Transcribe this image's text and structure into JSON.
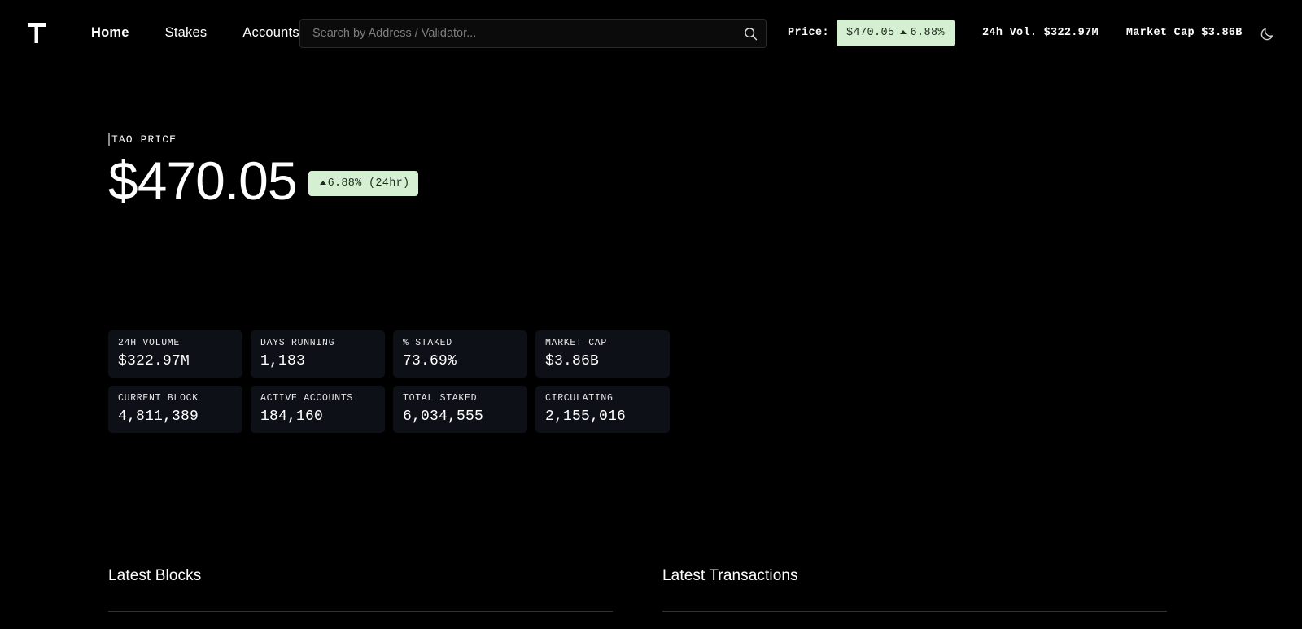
{
  "header": {
    "logo_icon": "tau-logo-icon",
    "nav": [
      {
        "label": "Home",
        "active": true
      },
      {
        "label": "Stakes",
        "active": false
      },
      {
        "label": "Accounts",
        "active": false
      }
    ],
    "search": {
      "placeholder": "Search by Address / Validator...",
      "value": "",
      "icon": "search-icon"
    },
    "price_label": "Price:",
    "price_badge": {
      "value": "$470.05",
      "change": "6.88%",
      "direction": "up"
    },
    "stats": [
      {
        "text": "24h Vol. $322.97M"
      },
      {
        "text": "Market Cap $3.86B"
      }
    ],
    "theme_toggle_icon": "moon-icon"
  },
  "hero": {
    "label": "TAO PRICE",
    "price": "$470.05",
    "change": "6.88% (24hr)",
    "direction": "up"
  },
  "cards": [
    {
      "label": "24H VOLUME",
      "value": "$322.97M"
    },
    {
      "label": "DAYS RUNNING",
      "value": "1,183"
    },
    {
      "label": "% STAKED",
      "value": "73.69%"
    },
    {
      "label": "MARKET CAP",
      "value": "$3.86B"
    },
    {
      "label": "CURRENT BLOCK",
      "value": "4,811,389"
    },
    {
      "label": "ACTIVE ACCOUNTS",
      "value": "184,160"
    },
    {
      "label": "TOTAL STAKED",
      "value": "6,034,555"
    },
    {
      "label": "CIRCULATING",
      "value": "2,155,016"
    }
  ],
  "sections": {
    "latest_blocks_title": "Latest Blocks",
    "latest_transactions_title": "Latest Transactions"
  },
  "colors": {
    "background": "#000000",
    "card_background": "#0d1117",
    "accent_green_bg": "#d4efd1",
    "accent_green_text": "#1d2b1d",
    "divider": "#333333"
  }
}
